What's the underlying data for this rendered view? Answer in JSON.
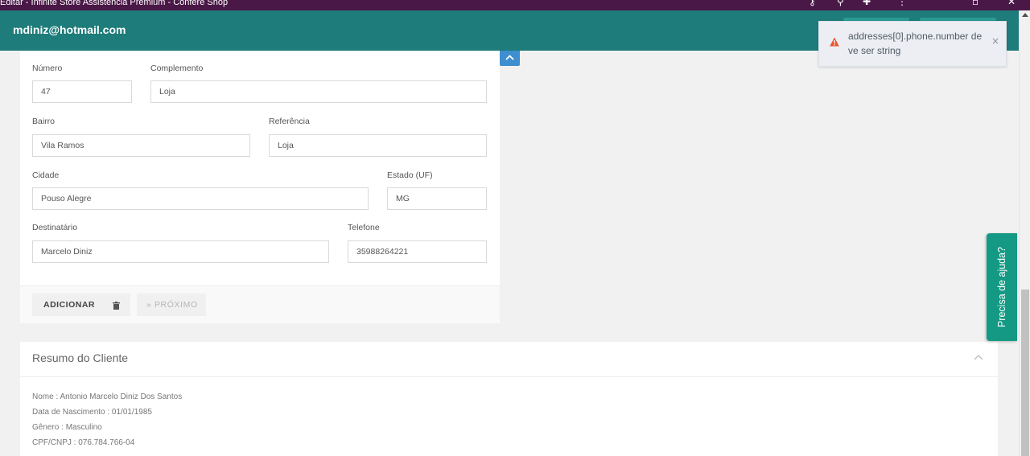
{
  "window": {
    "title": "Editar - Infinite Store Assistência Premium - Confere Shop"
  },
  "header": {
    "email": "mdiniz@hotmail.com"
  },
  "toast": {
    "message": "addresses[0].phone.number deve ser string",
    "close": "×",
    "icon": "warning-icon",
    "color": "#e8542b"
  },
  "form": {
    "numero": {
      "label": "Número",
      "value": "47"
    },
    "complemento": {
      "label": "Complemento",
      "value": "Loja"
    },
    "bairro": {
      "label": "Bairro",
      "value": "Vila Ramos"
    },
    "referencia": {
      "label": "Referência",
      "value": "Loja"
    },
    "cidade": {
      "label": "Cidade",
      "value": "Pouso Alegre"
    },
    "estado": {
      "label": "Estado (UF)",
      "value": "MG"
    },
    "destinatario": {
      "label": "Destinatário",
      "value": "Marcelo Diniz"
    },
    "telefone": {
      "label": "Telefone",
      "value": "35988264221"
    }
  },
  "actions": {
    "add": "ADICIONAR",
    "next": "» PRÓXIMO"
  },
  "resumo": {
    "title": "Resumo do Cliente",
    "lines": [
      "Nome : Antonio Marcelo Diniz Dos Santos",
      "Data de Nascimento : 01/01/1985",
      "Gênero : Masculino",
      "CPF/CNPJ : 076.784.766-04"
    ]
  },
  "help": {
    "label": "Precisa de ajuda?"
  },
  "colors": {
    "header": "#1e7c7a",
    "help": "#149a84",
    "accent": "#3e8ed0",
    "titlebar": "#4a1846"
  }
}
